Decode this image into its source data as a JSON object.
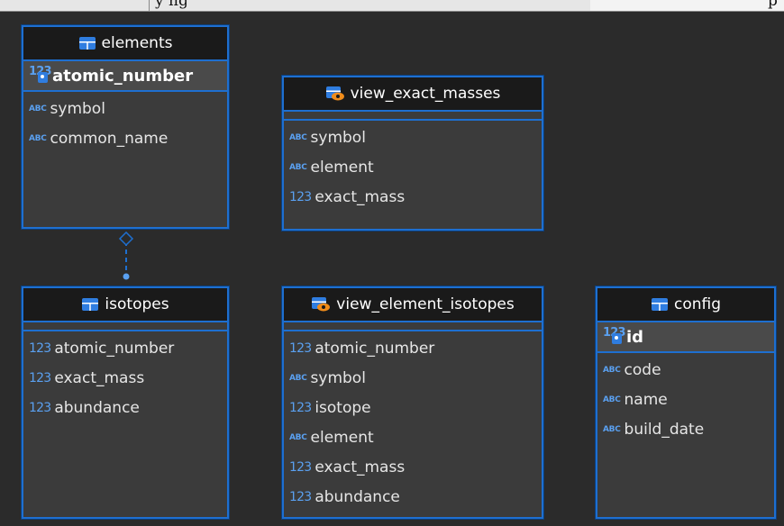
{
  "topbar": {
    "text_left": "",
    "text_mid": "y ng",
    "text_right": "p"
  },
  "colors": {
    "accent": "#1e6fd0",
    "header_bg": "#1a1a1a",
    "body_bg": "#3b3b3b",
    "canvas": "#2b2b2b"
  },
  "tables": {
    "elements": {
      "name": "elements",
      "icon": "table-icon",
      "pk": "atomic_number",
      "cols": [
        {
          "type": "ABC",
          "name": "symbol"
        },
        {
          "type": "ABC",
          "name": "common_name"
        }
      ]
    },
    "view_exact_masses": {
      "name": "view_exact_masses",
      "icon": "view-icon",
      "cols": [
        {
          "type": "ABC",
          "name": "symbol"
        },
        {
          "type": "ABC",
          "name": "element"
        },
        {
          "type": "123",
          "name": "exact_mass"
        }
      ]
    },
    "isotopes": {
      "name": "isotopes",
      "icon": "table-icon",
      "cols": [
        {
          "type": "123",
          "name": "atomic_number"
        },
        {
          "type": "123",
          "name": "exact_mass"
        },
        {
          "type": "123",
          "name": "abundance"
        }
      ]
    },
    "view_element_isotopes": {
      "name": "view_element_isotopes",
      "icon": "view-icon",
      "cols": [
        {
          "type": "123",
          "name": "atomic_number"
        },
        {
          "type": "ABC",
          "name": "symbol"
        },
        {
          "type": "123",
          "name": "isotope"
        },
        {
          "type": "ABC",
          "name": "element"
        },
        {
          "type": "123",
          "name": "exact_mass"
        },
        {
          "type": "123",
          "name": "abundance"
        }
      ]
    },
    "config": {
      "name": "config",
      "icon": "table-icon",
      "pk": "id",
      "cols": [
        {
          "type": "ABC",
          "name": "code"
        },
        {
          "type": "ABC",
          "name": "name"
        },
        {
          "type": "ABC",
          "name": "build_date"
        }
      ]
    }
  }
}
